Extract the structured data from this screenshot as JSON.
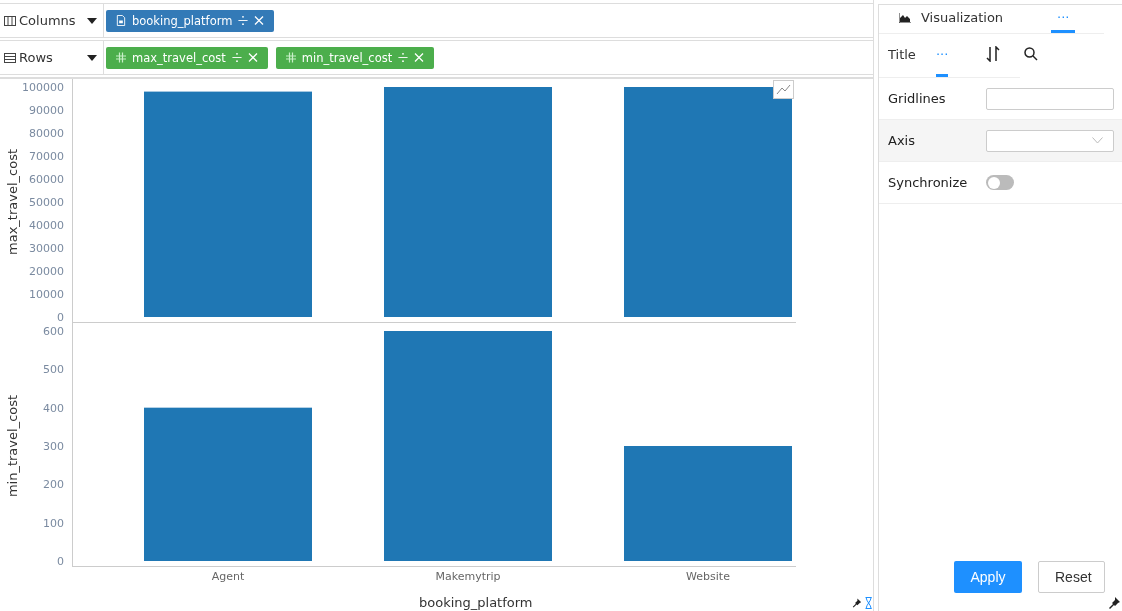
{
  "shelves": [
    {
      "label": "Columns",
      "kind": "columns",
      "pills": [
        {
          "label": "booking_platform",
          "kind": "dimension"
        }
      ]
    },
    {
      "label": "Rows",
      "kind": "rows",
      "pills": [
        {
          "label": "max_travel_cost",
          "kind": "measure"
        },
        {
          "label": "min_travel_cost",
          "kind": "measure"
        }
      ]
    }
  ],
  "charts": [
    {
      "chart_data": {
        "type": "bar",
        "ylabel": "max_travel_cost",
        "series": [
          {
            "color": "#1f77b4",
            "values": [
              98000,
              100000,
              100000
            ]
          }
        ],
        "ylim": [
          0,
          100000
        ],
        "yticks": [
          0,
          10000,
          20000,
          30000,
          40000,
          50000,
          60000,
          70000,
          80000,
          90000,
          100000
        ]
      }
    },
    {
      "chart_data": {
        "type": "bar",
        "xlabel": "booking_platform",
        "ylabel": "min_travel_cost",
        "categories": [
          "Agent",
          "Makemytrip",
          "Website"
        ],
        "series": [
          {
            "color": "#1f77b4",
            "values": [
              400,
              600,
              300
            ]
          }
        ],
        "ylim": [
          0,
          600
        ],
        "yticks": [
          0,
          100,
          200,
          300,
          400,
          500,
          600
        ]
      }
    }
  ],
  "panel": {
    "tabs": [
      {
        "label": "Visualization",
        "kind": "chart",
        "selected": false
      },
      {
        "label": "···",
        "kind": "text",
        "selected": true
      }
    ],
    "subtabs": [
      {
        "label": "Title",
        "kind": "text",
        "selected": false
      },
      {
        "label": "···",
        "kind": "text",
        "selected": true
      },
      {
        "kind": "sort",
        "selected": false
      },
      {
        "kind": "search",
        "selected": false
      }
    ],
    "properties": [
      {
        "label": "Gridlines",
        "kind": "text"
      },
      {
        "label": "Axis",
        "kind": "select"
      },
      {
        "label": "Synchronize",
        "kind": "toggle",
        "on": false
      }
    ],
    "buttons": [
      {
        "label": "Apply",
        "kind": "primary"
      },
      {
        "label": "Reset",
        "kind": "secondary"
      }
    ]
  }
}
